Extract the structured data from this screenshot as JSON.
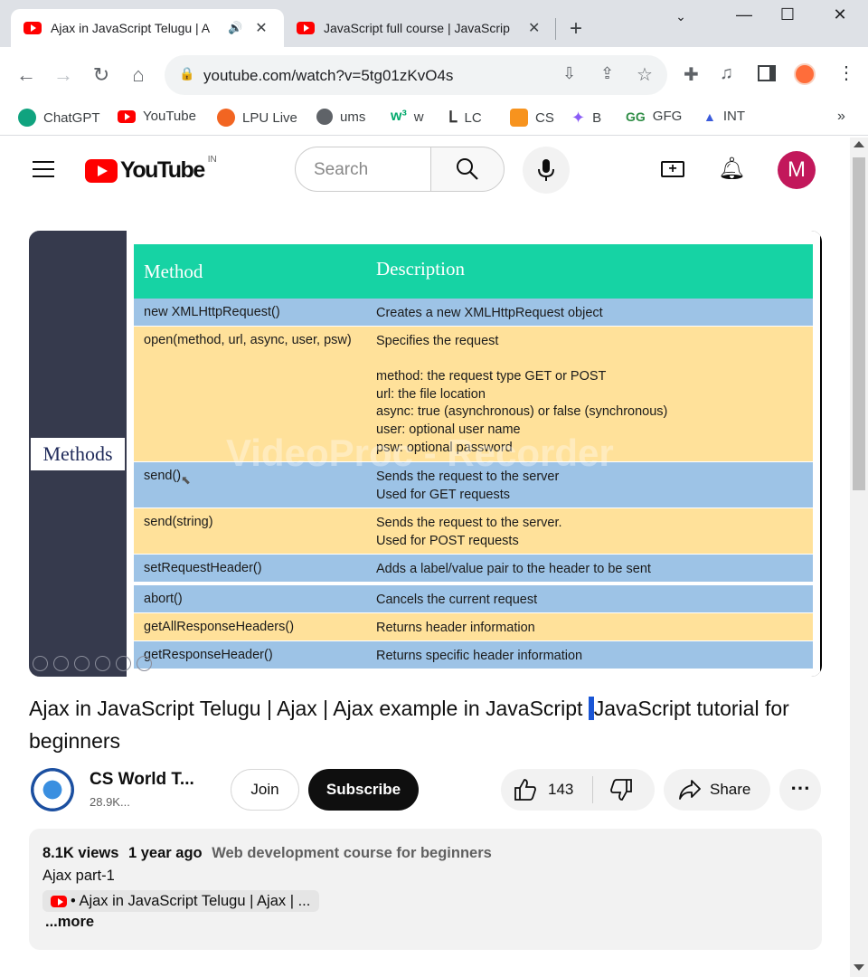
{
  "browser": {
    "tabs": [
      {
        "title": "Ajax in JavaScript Telugu | A",
        "active": true
      },
      {
        "title": "JavaScript full course | JavaScrip",
        "active": false
      }
    ],
    "url": "youtube.com/watch?v=5tg01zKvO4s",
    "bookmarks": [
      {
        "label": "ChatGPT",
        "color": "#10a37f"
      },
      {
        "label": "YouTube",
        "color": "#ff0000"
      },
      {
        "label": "LPU Live",
        "color": "#f26522"
      },
      {
        "label": "ums",
        "color": "#5f6368"
      },
      {
        "label": "w",
        "color": "#04aa6d"
      },
      {
        "label": "LC",
        "color": "#ffa116"
      },
      {
        "label": "CS",
        "color": "#f7931e"
      },
      {
        "label": "B",
        "color": "#8a5cf6"
      },
      {
        "label": "GFG",
        "color": "#2f8d46"
      },
      {
        "label": "INT",
        "color": "#3b5bdb"
      }
    ],
    "bookmarks_overflow": "»"
  },
  "youtube": {
    "logo_text": "YouTube",
    "region": "IN",
    "search_placeholder": "Search",
    "avatar_letter": "M",
    "avatar_color": "#c2185b"
  },
  "video": {
    "side_label": "Methods",
    "watermark": "VideoProc - Recorder",
    "table": {
      "headers": [
        "Method",
        "Description"
      ],
      "rows": [
        {
          "method": "new XMLHttpRequest()",
          "description": [
            "Creates a new XMLHttpRequest object"
          ],
          "color": "blue"
        },
        {
          "method": "open(method, url, async, user, psw)",
          "description": [
            "Specifies the request",
            "",
            "method: the request type GET or POST",
            "url: the file location",
            "async: true (asynchronous) or false (synchronous)",
            "user: optional user name",
            "psw: optional password"
          ],
          "color": "yellow"
        },
        {
          "method": "send()",
          "description": [
            "Sends the request to the server",
            "Used for GET requests"
          ],
          "color": "blue"
        },
        {
          "method": "send(string)",
          "description": [
            "Sends the request to the server.",
            "Used for POST requests"
          ],
          "color": "yellow"
        },
        {
          "method": "setRequestHeader()",
          "description": [
            "Adds a label/value pair to the header to be sent"
          ],
          "color": "blue"
        },
        {
          "method": "abort()",
          "description": [
            "Cancels the current request"
          ],
          "color": "blue"
        },
        {
          "method": "getAllResponseHeaders()",
          "description": [
            "Returns header information"
          ],
          "color": "yellow"
        },
        {
          "method": "getResponseHeader()",
          "description": [
            "Returns specific header information"
          ],
          "color": "blue"
        }
      ]
    },
    "title_part1": "Ajax in JavaScript Telugu | Ajax | Ajax example in JavaScript ",
    "title_caret": "|",
    "title_part2": "JavaScript tutorial for beginners"
  },
  "channel": {
    "name": "CS World T...",
    "subscribers": "28.9K...",
    "join_label": "Join",
    "subscribe_label": "Subscribe"
  },
  "actions": {
    "likes": "143",
    "share_label": "Share"
  },
  "description": {
    "views": "8.1K views",
    "age": "1 year ago",
    "playlist": "Web development course for beginners",
    "line1": "Ajax part-1",
    "chip": "• Ajax in JavaScript  Telugu | Ajax  | ...",
    "more": "...more"
  }
}
